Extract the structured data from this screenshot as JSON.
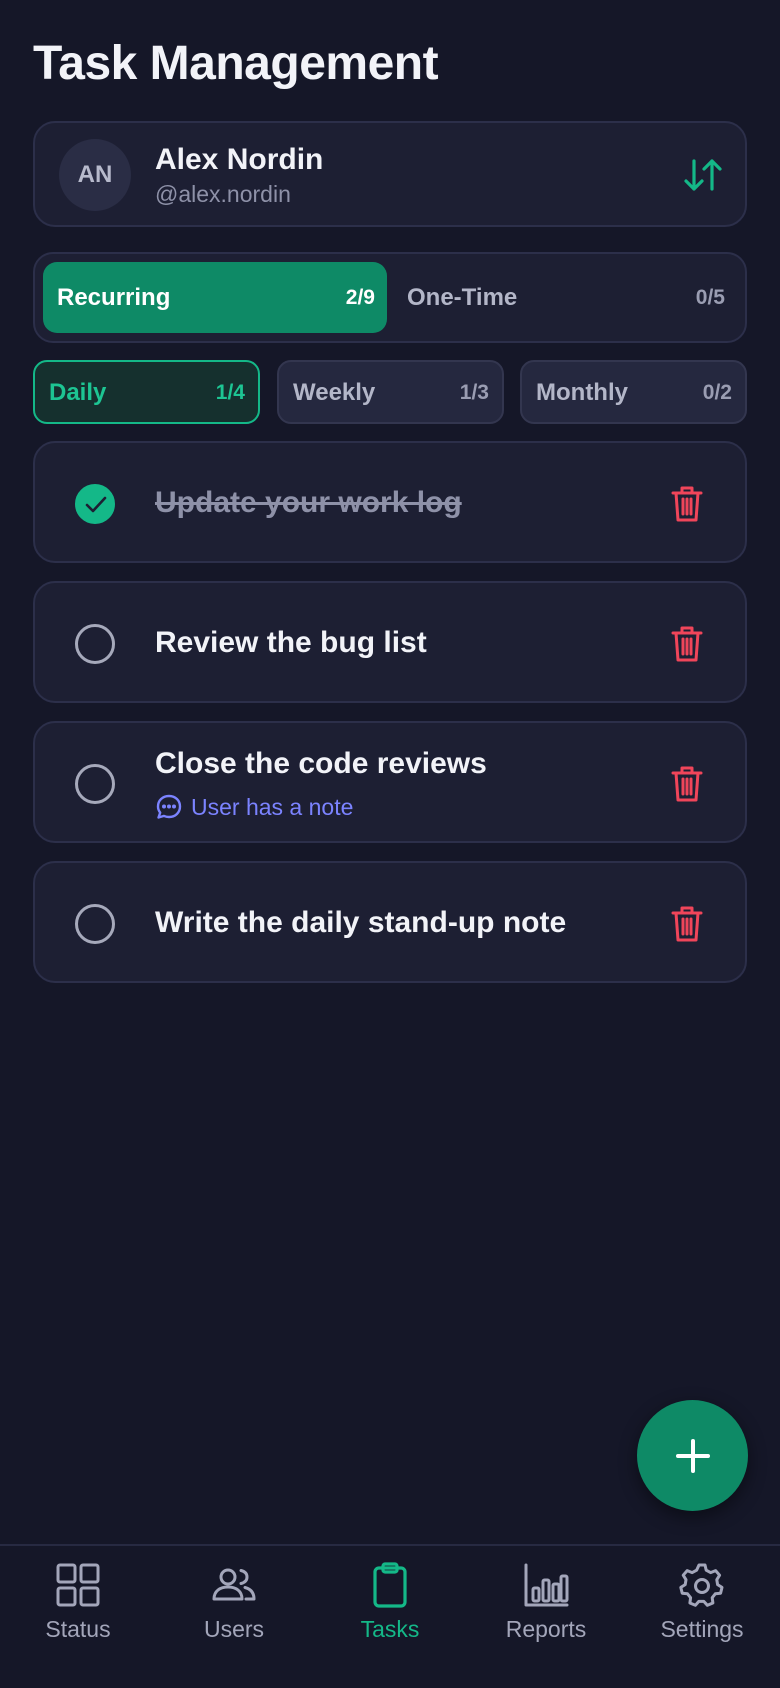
{
  "header": {
    "title": "Task Management"
  },
  "user": {
    "initials": "AN",
    "name": "Alex Nordin",
    "handle": "@alex.nordin",
    "sort_icon": "sort-arrows-icon"
  },
  "segments": [
    {
      "label": "Recurring",
      "count": "2/9",
      "active": true
    },
    {
      "label": "One-Time",
      "count": "0/5",
      "active": false
    }
  ],
  "periods": [
    {
      "label": "Daily",
      "count": "1/4",
      "active": true
    },
    {
      "label": "Weekly",
      "count": "1/3",
      "active": false
    },
    {
      "label": "Monthly",
      "count": "0/2",
      "active": false
    }
  ],
  "tasks": [
    {
      "title": "Update your work log",
      "done": true
    },
    {
      "title": "Review the bug list",
      "done": false
    },
    {
      "title": "Close the code reviews",
      "done": false,
      "note": "User has a note"
    },
    {
      "title": "Write the daily stand-up note",
      "done": false
    }
  ],
  "fab": {
    "icon": "plus-icon"
  },
  "nav": [
    {
      "label": "Status",
      "icon": "grid-icon",
      "active": false
    },
    {
      "label": "Users",
      "icon": "users-icon",
      "active": false
    },
    {
      "label": "Tasks",
      "icon": "clipboard-icon",
      "active": true
    },
    {
      "label": "Reports",
      "icon": "bar-chart-icon",
      "active": false
    },
    {
      "label": "Settings",
      "icon": "gear-icon",
      "active": false
    }
  ],
  "colors": {
    "background": "#151728",
    "accent": "#14B888",
    "accent_dark": "#0E8A66",
    "danger": "#F0455A",
    "note": "#7B83FF"
  }
}
